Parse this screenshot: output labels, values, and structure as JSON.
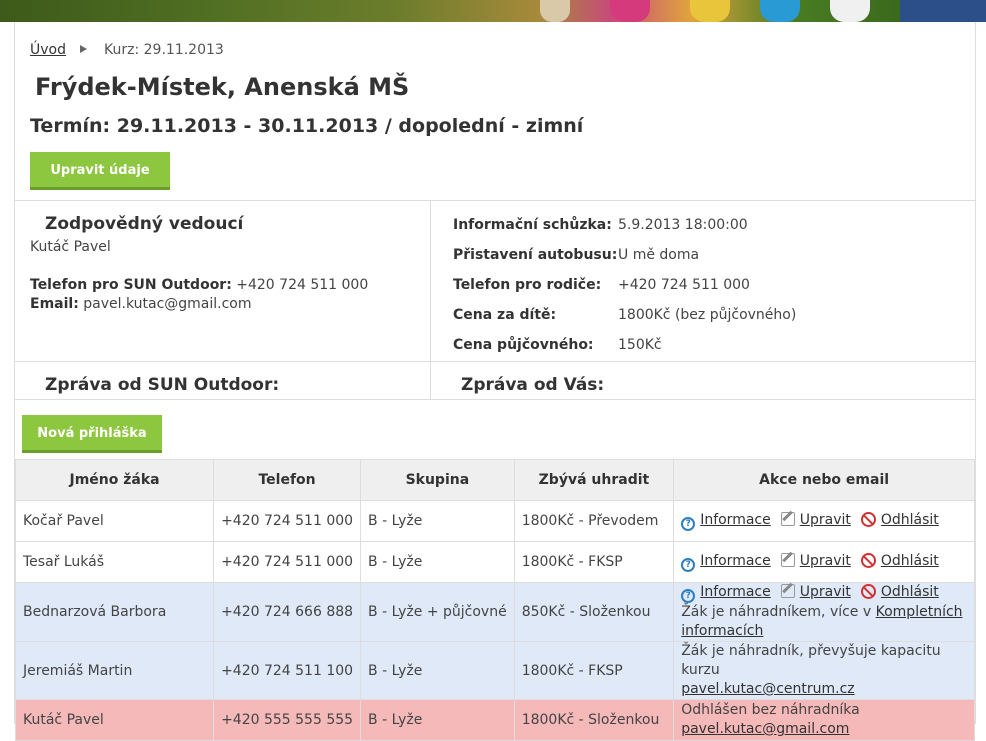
{
  "breadcrumb": {
    "home": "Úvod",
    "current": "Kurz: 29.11.2013"
  },
  "course": {
    "title": "Frýdek-Místek, Anenská MŠ",
    "term": "Termín: 29.11.2013 - 30.11.2013 / dopolední - zimní",
    "edit_button": "Upravit údaje"
  },
  "leader": {
    "heading": "Zodpovědný vedoucí",
    "name": "Kutáč Pavel",
    "phone_label": "Telefon pro SUN Outdoor:",
    "phone": "+420 724 511 000",
    "email_label": "Email:",
    "email": "pavel.kutac@gmail.com"
  },
  "info": [
    {
      "label": "Informační schůzka:",
      "value": "5.9.2013 18:00:00"
    },
    {
      "label": "Přistavení autobusu:",
      "value": "U mě doma"
    },
    {
      "label": "Telefon pro rodiče:",
      "value": "+420 724 511 000"
    },
    {
      "label": "Cena za dítě:",
      "value": "1800Kč (bez půjčovného)"
    },
    {
      "label": "Cena půjčovného:",
      "value": "150Kč"
    }
  ],
  "messages": {
    "from_sun": "Zpráva od SUN Outdoor:",
    "from_you": "Zpráva od Vás:"
  },
  "new_application_button": "Nová přihláška",
  "table": {
    "headers": [
      "Jméno žáka",
      "Telefon",
      "Skupina",
      "Zbývá uhradit",
      "Akce nebo email"
    ],
    "actions": {
      "info": "Informace",
      "edit": "Upravit",
      "logout": "Odhlásit"
    },
    "rows": [
      {
        "name": "Kočař Pavel",
        "phone": "+420 724 511 000",
        "group": "B - Lyže",
        "due": "1800Kč - Převodem"
      },
      {
        "name": "Tesař Lukáš",
        "phone": "+420 724 511 000",
        "group": "B - Lyže",
        "due": "1800Kč - FKSP"
      },
      {
        "name": "Bednarzová Barbora",
        "phone": "+420 724 666 888",
        "group": "B - Lyže + půjčovné",
        "due": "850Kč - Složenkou",
        "note": "Žák je náhradníkem, více v",
        "note_link": "Kompletních informacích"
      },
      {
        "name": "Jeremiáš Martin",
        "phone": "+420 724 511 100",
        "group": "B - Lyže",
        "due": "1800Kč - FKSP",
        "note": "Žák je náhradník, převyšuje kapacitu kurzu",
        "note_link": "pavel.kutac@centrum.cz"
      },
      {
        "name": "Kutáč Pavel",
        "phone": "+420 555 555 555",
        "group": "B - Lyže",
        "due": "1800Kč - Složenkou",
        "note": "Odhlášen bez náhradníka",
        "note_link": "pavel.kutac@gmail.com"
      }
    ]
  }
}
